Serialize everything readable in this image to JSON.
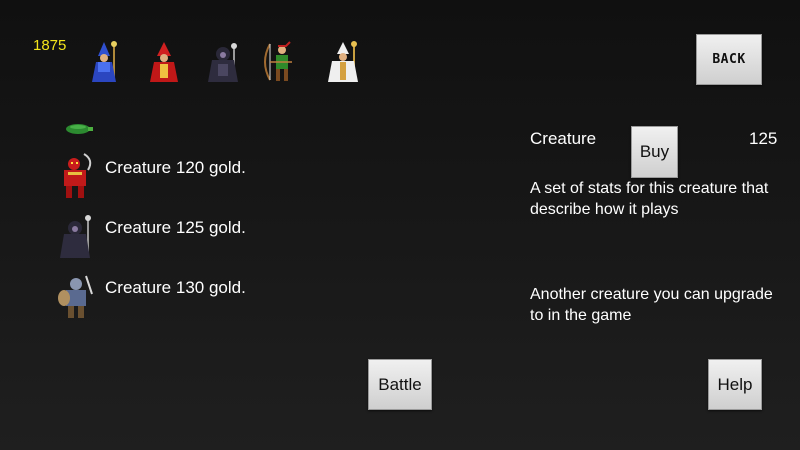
{
  "hud": {
    "gold": "1875"
  },
  "party": [
    {
      "icon": "blue-wizard-icon"
    },
    {
      "icon": "red-mage-icon"
    },
    {
      "icon": "dark-necromancer-icon"
    },
    {
      "icon": "green-archer-icon"
    },
    {
      "icon": "white-priest-icon"
    }
  ],
  "buttons": {
    "back": "BACK",
    "battle": "Battle",
    "help": "Help",
    "buy": "Buy"
  },
  "list": {
    "top_icon": "green-turtle-icon",
    "items": [
      {
        "icon": "red-demon-icon",
        "label": "Creature 120 gold."
      },
      {
        "icon": "dark-necromancer-icon",
        "label": "Creature 125 gold."
      },
      {
        "icon": "armored-knight-icon",
        "label": "Creature 130 gold."
      }
    ]
  },
  "detail": {
    "name": "Creature",
    "cost": "125",
    "description": "A set of stats for this creature that describe how it plays",
    "upgrade": "Another creature you can upgrade to in the game"
  },
  "colors": {
    "gold_text": "#f3e41c",
    "background": "#161616",
    "button": "#dcdcdc"
  }
}
